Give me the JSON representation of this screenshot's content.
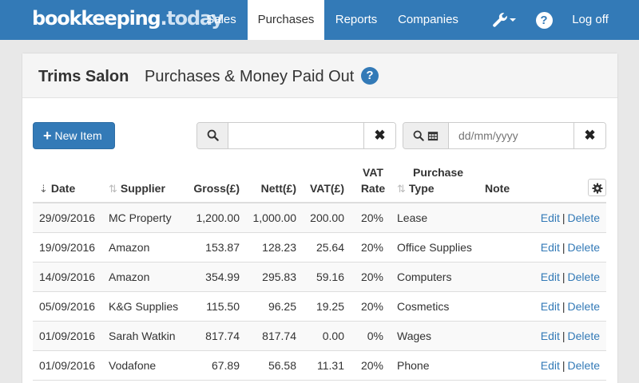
{
  "brand": {
    "name": "bookkeeping",
    "dot": ".",
    "tld": "today"
  },
  "nav": {
    "sales": "Sales",
    "purchases": "Purchases",
    "reports": "Reports",
    "companies": "Companies",
    "tools_icon": "wrench-icon",
    "help_icon": "question-circle-icon",
    "help_glyph": "?",
    "logoff": "Log off"
  },
  "panel": {
    "company": "Trims Salon",
    "title": "Purchases & Money Paid Out",
    "help_glyph": "?"
  },
  "toolbar": {
    "new_item": "New Item",
    "search_value": "",
    "search_placeholder": "",
    "date_placeholder": "dd/mm/yyyy"
  },
  "table": {
    "headers": {
      "date": "Date",
      "supplier": "Supplier",
      "gross": "Gross(£)",
      "nett": "Nett(£)",
      "vat": "VAT(£)",
      "vat_rate_line1": "VAT",
      "vat_rate_line2": "Rate",
      "type_line1": "Purchase",
      "type_line2": "Type",
      "note": "Note"
    },
    "rows": [
      {
        "date": "29/09/2016",
        "supplier": "MC Property",
        "gross": "1,200.00",
        "nett": "1,000.00",
        "vat": "200.00",
        "rate": "20%",
        "type": "Lease",
        "note": ""
      },
      {
        "date": "19/09/2016",
        "supplier": "Amazon",
        "gross": "153.87",
        "nett": "128.23",
        "vat": "25.64",
        "rate": "20%",
        "type": "Office Supplies",
        "note": ""
      },
      {
        "date": "14/09/2016",
        "supplier": "Amazon",
        "gross": "354.99",
        "nett": "295.83",
        "vat": "59.16",
        "rate": "20%",
        "type": "Computers",
        "note": ""
      },
      {
        "date": "05/09/2016",
        "supplier": "K&G Supplies",
        "gross": "115.50",
        "nett": "96.25",
        "vat": "19.25",
        "rate": "20%",
        "type": "Cosmetics",
        "note": ""
      },
      {
        "date": "01/09/2016",
        "supplier": "Sarah Watkin",
        "gross": "817.74",
        "nett": "817.74",
        "vat": "0.00",
        "rate": "0%",
        "type": "Wages",
        "note": ""
      },
      {
        "date": "01/09/2016",
        "supplier": "Vodafone",
        "gross": "67.89",
        "nett": "56.58",
        "vat": "11.31",
        "rate": "20%",
        "type": "Phone",
        "note": ""
      }
    ],
    "actions": {
      "edit": "Edit",
      "separator": "|",
      "delete": "Delete"
    }
  }
}
